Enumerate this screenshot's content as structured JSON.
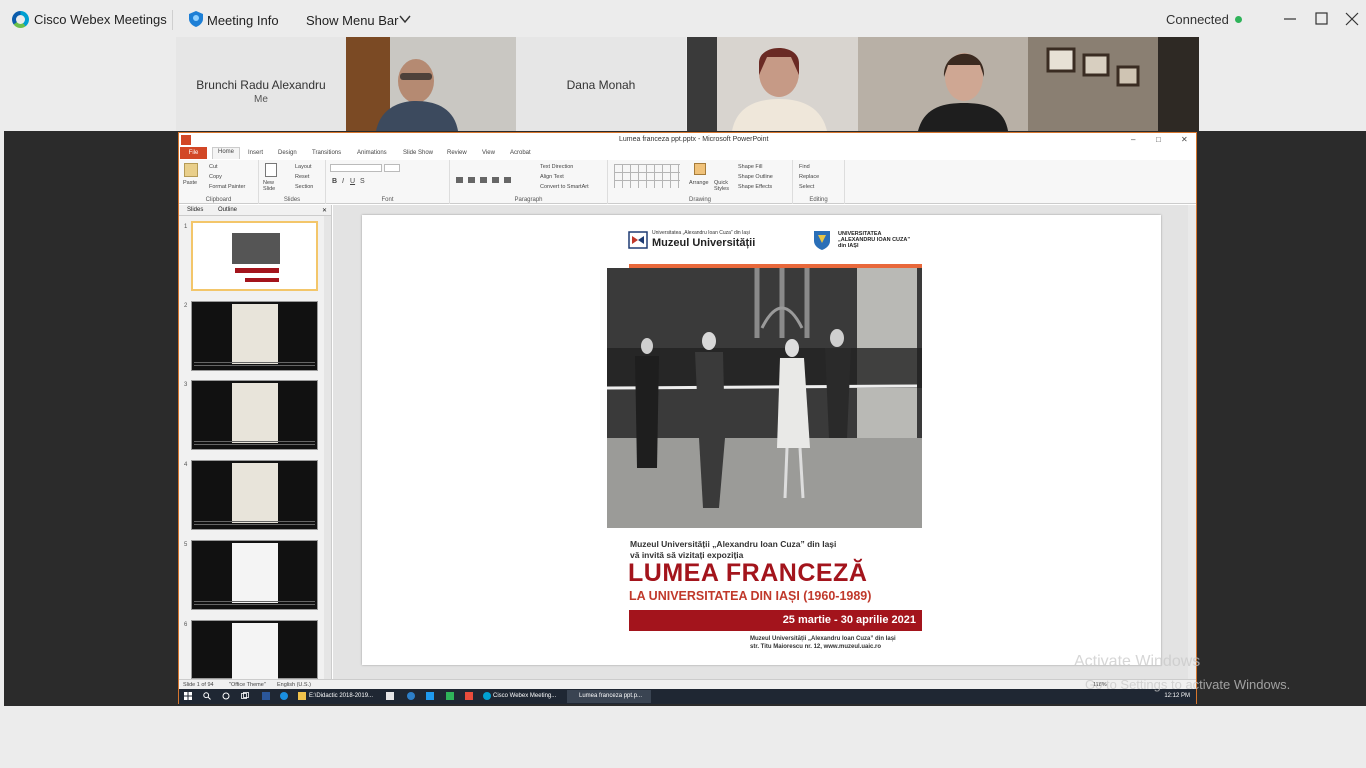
{
  "webex": {
    "app_name": "Cisco Webex Meetings",
    "meeting_info": "Meeting Info",
    "show_menu_bar": "Show Menu Bar",
    "status": "Connected",
    "status_color": "#2fb35a",
    "icons": [
      "webex-logo-icon",
      "shield-info-icon",
      "chevron-down-icon",
      "minimize-icon",
      "maximize-icon",
      "close-icon"
    ]
  },
  "participants": [
    {
      "name": "Brunchi Radu Alexandru",
      "sub": "Me"
    },
    {
      "name": "Dana Monah"
    }
  ],
  "powerpoint": {
    "title": "Lumea franceza ppt.pptx - Microsoft PowerPoint",
    "tabs": [
      "File",
      "Home",
      "Insert",
      "Design",
      "Transitions",
      "Animations",
      "Slide Show",
      "Review",
      "View",
      "Acrobat"
    ],
    "groups": {
      "clipboard": {
        "label": "Clipboard",
        "paste": "Paste",
        "cut": "Cut",
        "copy": "Copy",
        "format_painter": "Format Painter"
      },
      "slides": {
        "label": "Slides",
        "new_slide": "New Slide",
        "layout": "Layout",
        "reset": "Reset",
        "section": "Section"
      },
      "font": {
        "label": "Font"
      },
      "paragraph": {
        "label": "Paragraph",
        "text_direction": "Text Direction",
        "align_text": "Align Text",
        "convert_smartart": "Convert to SmartArt"
      },
      "drawing": {
        "label": "Drawing",
        "arrange": "Arrange",
        "quick_styles": "Quick Styles",
        "shape_fill": "Shape Fill",
        "shape_outline": "Shape Outline",
        "shape_effects": "Shape Effects"
      },
      "editing": {
        "label": "Editing",
        "find": "Find",
        "replace": "Replace",
        "select": "Select"
      }
    },
    "pane_tabs": [
      "Slides",
      "Outline"
    ],
    "thumb_numbers": [
      "1",
      "2",
      "3",
      "4",
      "5",
      "6"
    ],
    "status": {
      "slide": "Slide 1 of 94",
      "theme": "\"Office Theme\"",
      "lang": "English (U.S.)",
      "zoom": "118%"
    }
  },
  "slide": {
    "muzeu_small": "Universitatea „Alexandru Ioan Cuza” din Iași",
    "muzeu_big": "Muzeul Universității",
    "uni_line1": "UNIVERSITATEA",
    "uni_line2": "„ALEXANDRU IOAN CUZA”",
    "uni_line3": "din IAȘI",
    "invite_line1": "Muzeul Universității „Alexandru Ioan Cuza” din Iași",
    "invite_line2": "vă invită să vizitați expoziția",
    "headline": "LUMEA FRANCEZĂ",
    "subhead": "LA UNIVERSITATEA DIN IAȘI (1960-1989)",
    "dates": "25 martie - 30 aprilie 2021",
    "footer_line1": "Muzeul Universității „Alexandru Ioan Cuza” din Iași",
    "footer_line2": "str. Titu Maiorescu nr. 12, www.muzeul.uaic.ro",
    "accent_red": "#a3141c",
    "accent_orange": "#e8683b"
  },
  "taskbar": {
    "apps": [
      "E:\\Didactic 2018-2019...",
      "Cisco Webex Meeting...",
      "Lumea franceza ppt.p..."
    ],
    "time": "12:12 PM"
  },
  "watermark": {
    "line1": "Activate Windows",
    "line2": "Go to Settings to activate Windows."
  }
}
